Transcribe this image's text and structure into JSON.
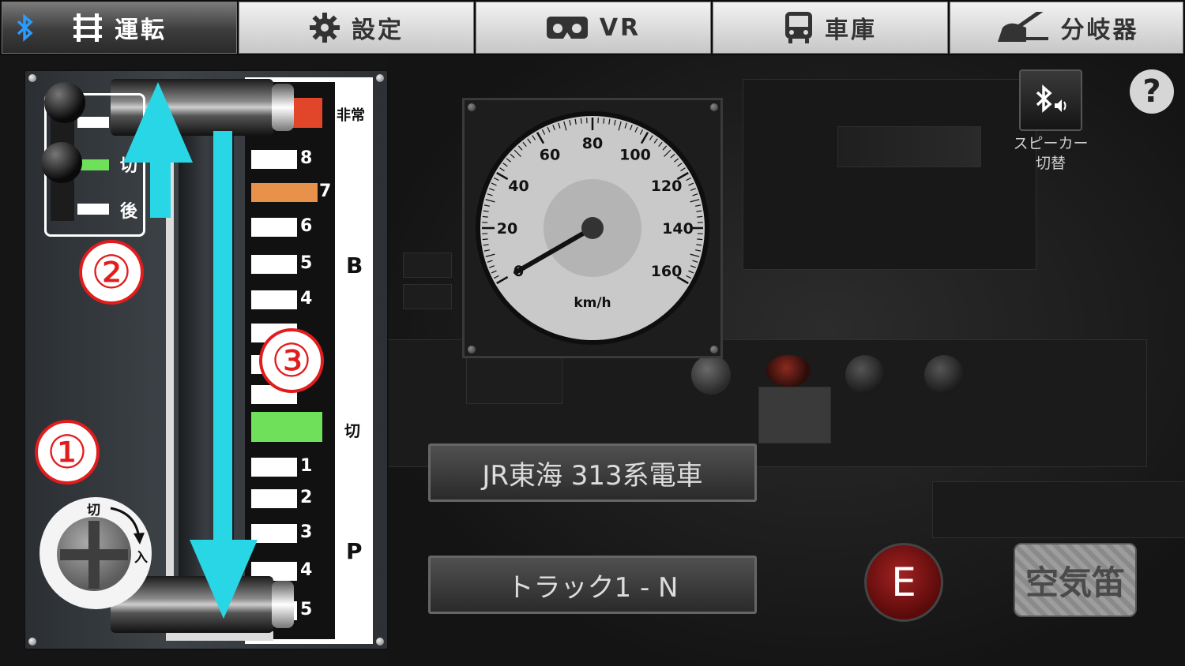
{
  "tabs": [
    {
      "label": "運転",
      "icon": "track-icon",
      "active": true
    },
    {
      "label": "設定",
      "icon": "gear-icon",
      "active": false
    },
    {
      "label": "VR",
      "icon": "vr-goggles-icon",
      "active": false
    },
    {
      "label": "車庫",
      "icon": "train-icon",
      "active": false
    },
    {
      "label": "分岐器",
      "icon": "switch-machine-icon",
      "active": false
    }
  ],
  "bluetooth_icon": "bluetooth-icon",
  "controller": {
    "emergency_label": "非常",
    "brake_zone_label": "B",
    "off_label": "切",
    "power_zone_label": "P",
    "brake_notches": [
      "8",
      "7",
      "6",
      "5",
      "4"
    ],
    "power_notches": [
      "1",
      "2",
      "3",
      "4",
      "5"
    ],
    "reverser": {
      "neutral_label": "切",
      "reverse_label": "後"
    },
    "key_switch": {
      "off_label": "切",
      "on_label": "入"
    },
    "callouts": [
      "①",
      "②",
      "③"
    ]
  },
  "speedometer": {
    "unit": "km/h",
    "ticks": [
      "0",
      "20",
      "40",
      "60",
      "80",
      "100",
      "120",
      "140",
      "160"
    ],
    "max": 160,
    "value": 0
  },
  "speaker": {
    "label_line1": "スピーカー",
    "label_line2": "切替"
  },
  "help_label": "?",
  "train_name": "JR東海 313系電車",
  "track_label": "トラック1 - N",
  "emergency_button_label": "E",
  "horn_button_label": "空気笛",
  "colors": {
    "accent_cyan": "#29d6e6",
    "emergency_red": "#e2462a",
    "notch7_orange": "#e8914a",
    "off_green": "#6ee05a",
    "callout_red": "#e21c1c"
  }
}
